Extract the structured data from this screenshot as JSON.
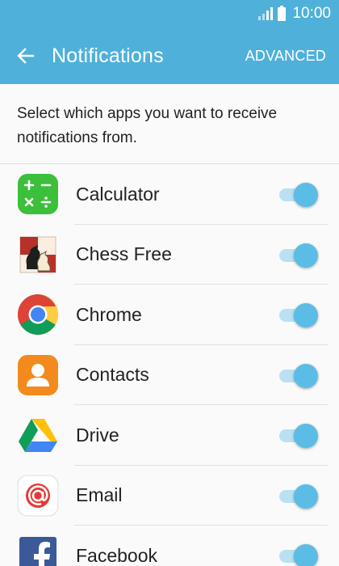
{
  "status": {
    "time": "10:00"
  },
  "header": {
    "title": "Notifications",
    "advanced_label": "ADVANCED",
    "accent": "#4fb1da"
  },
  "description": "Select which apps you want to receive notifications from.",
  "apps": [
    {
      "name": "Calculator",
      "icon": "calculator-icon",
      "enabled": true
    },
    {
      "name": "Chess Free",
      "icon": "chess-icon",
      "enabled": true
    },
    {
      "name": "Chrome",
      "icon": "chrome-icon",
      "enabled": true
    },
    {
      "name": "Contacts",
      "icon": "contacts-icon",
      "enabled": true
    },
    {
      "name": "Drive",
      "icon": "drive-icon",
      "enabled": true
    },
    {
      "name": "Email",
      "icon": "email-icon",
      "enabled": true
    },
    {
      "name": "Facebook",
      "icon": "facebook-icon",
      "enabled": true
    }
  ]
}
